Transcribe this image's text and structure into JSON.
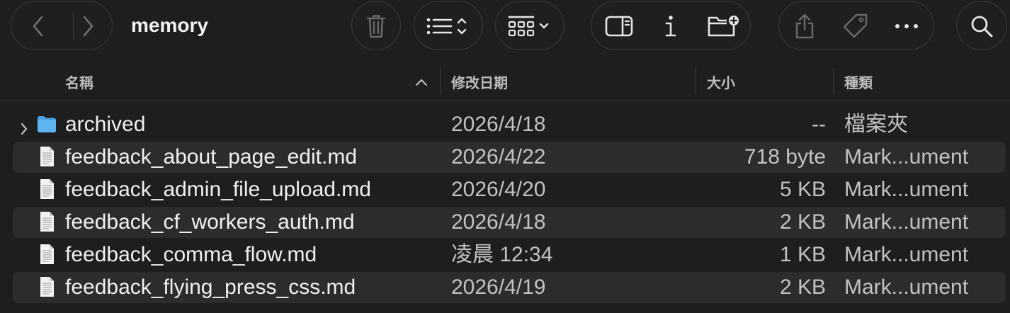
{
  "toolbar": {
    "window_title": "memory",
    "buttons": [
      {
        "name": "back-button",
        "icon": "chevron-left-icon"
      },
      {
        "name": "forward-button",
        "icon": "chevron-right-icon"
      },
      {
        "name": "delete-button",
        "icon": "trash-icon"
      },
      {
        "name": "list-view-button",
        "icon": "list-view-icon"
      },
      {
        "name": "group-button",
        "icon": "grid-group-icon"
      },
      {
        "name": "preview-pane-button",
        "icon": "sidebar-panel-icon"
      },
      {
        "name": "get-info-button",
        "icon": "info-icon"
      },
      {
        "name": "new-folder-button",
        "icon": "new-folder-icon"
      },
      {
        "name": "share-button",
        "icon": "share-icon"
      },
      {
        "name": "tag-button",
        "icon": "tag-icon"
      },
      {
        "name": "more-button",
        "icon": "ellipsis-icon"
      },
      {
        "name": "search-button",
        "icon": "search-icon"
      }
    ]
  },
  "columns": {
    "name": "名稱",
    "date": "修改日期",
    "size": "大小",
    "kind": "種類",
    "sort_direction": "ascending"
  },
  "files": [
    {
      "name": "archived",
      "date": "2026/4/18",
      "size": "--",
      "kind": "檔案夾",
      "type": "folder"
    },
    {
      "name": "feedback_about_page_edit.md",
      "date": "2026/4/22",
      "size": "718 byte",
      "kind": "Mark...ument",
      "type": "document"
    },
    {
      "name": "feedback_admin_file_upload.md",
      "date": "2026/4/20",
      "size": "5 KB",
      "kind": "Mark...ument",
      "type": "document"
    },
    {
      "name": "feedback_cf_workers_auth.md",
      "date": "2026/4/18",
      "size": "2 KB",
      "kind": "Mark...ument",
      "type": "document"
    },
    {
      "name": "feedback_comma_flow.md",
      "date": "凌晨 12:34",
      "size": "1 KB",
      "kind": "Mark...ument",
      "type": "document"
    },
    {
      "name": "feedback_flying_press_css.md",
      "date": "2026/4/19",
      "size": "2 KB",
      "kind": "Mark...ument",
      "type": "document"
    }
  ],
  "colors": {
    "background": "#1e1e1e",
    "row_alt": "#2c2c2c",
    "folder_blue": "#5fb4ef",
    "text_primary": "#f0f0f0",
    "text_secondary": "#c2c2c2"
  }
}
